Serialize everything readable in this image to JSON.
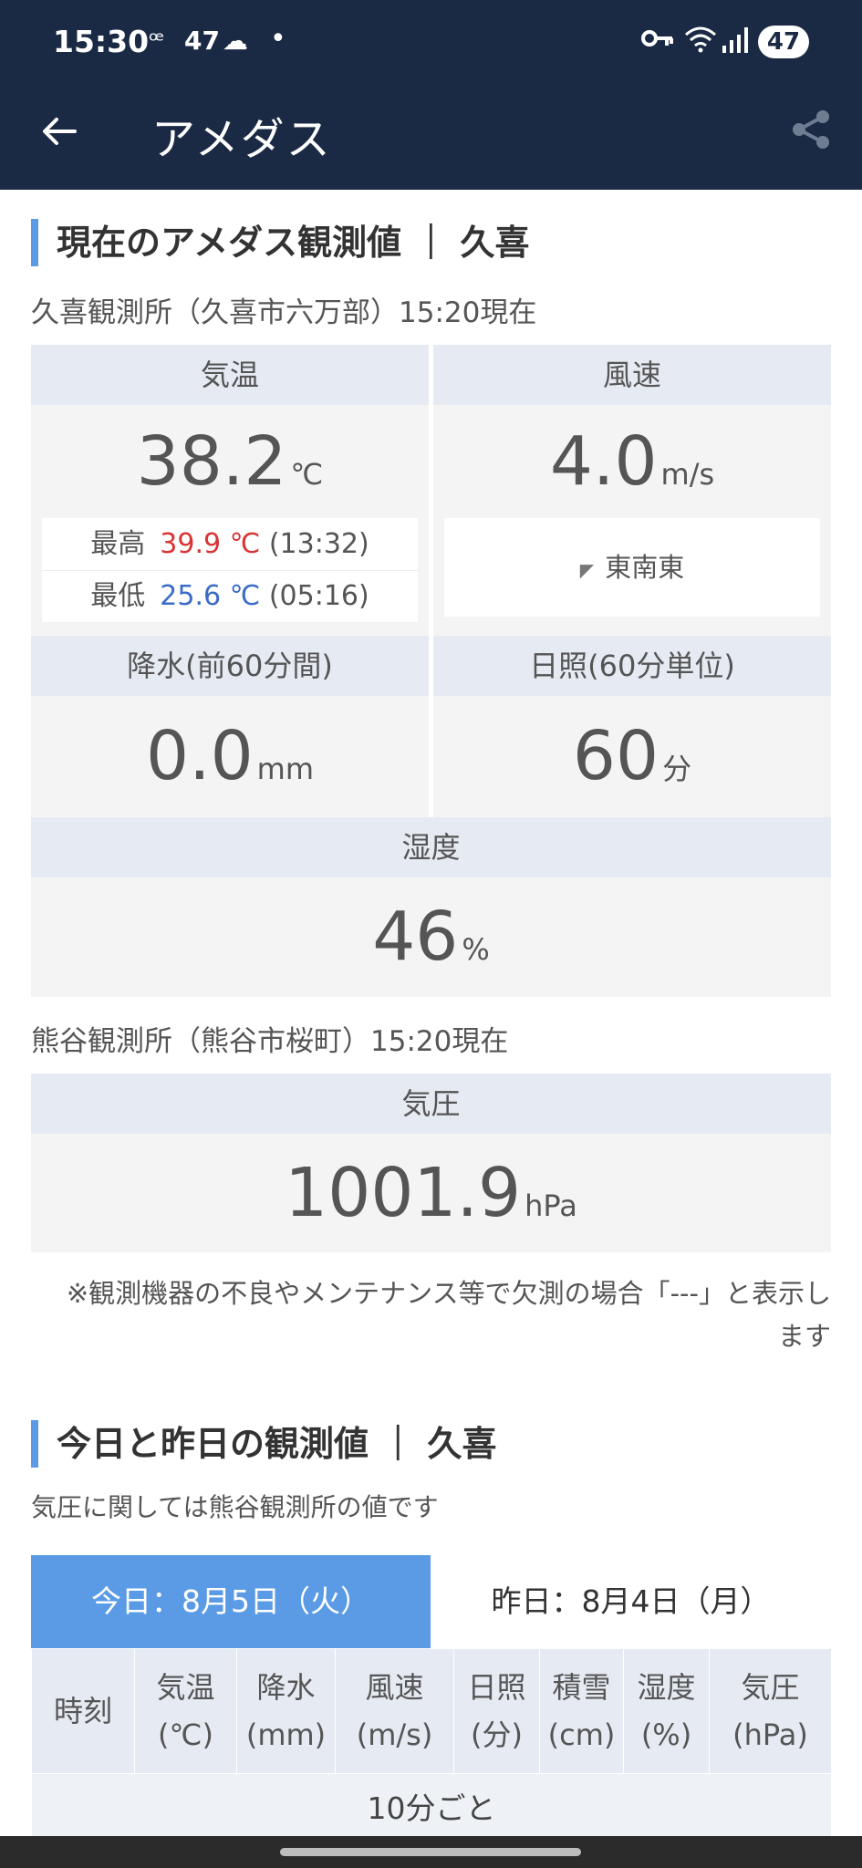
{
  "status_bar": {
    "time": "15:30",
    "temp": "47",
    "battery": "47",
    "icons": [
      "dnd-icon",
      "cloud-icon",
      "key-icon",
      "wifi-icon",
      "signal-icon",
      "battery-icon"
    ]
  },
  "app_bar": {
    "title": "アメダス",
    "icons": [
      "back-arrow-icon",
      "share-icon"
    ]
  },
  "current": {
    "section_title": "現在のアメダス観測値 ｜ 久喜",
    "station": "久喜観測所（久喜市六万部）15:20現在",
    "temperature": {
      "label": "気温",
      "value": "38.2",
      "unit": "℃",
      "max_label": "最高",
      "max_value": "39.9 ℃",
      "max_time": "(13:32)",
      "min_label": "最低",
      "min_value": "25.6 ℃",
      "min_time": "(05:16)"
    },
    "wind": {
      "label": "風速",
      "value": "4.0",
      "unit": "m/s",
      "direction": "東南東"
    },
    "precip": {
      "label": "降水(前60分間)",
      "value": "0.0",
      "unit": "mm"
    },
    "sunshine": {
      "label": "日照(60分単位)",
      "value": "60",
      "unit": "分"
    },
    "humidity": {
      "label": "湿度",
      "value": "46",
      "unit": "%"
    },
    "pressure_station": "熊谷観測所（熊谷市桜町）15:20現在",
    "pressure": {
      "label": "気圧",
      "value": "1001.9",
      "unit": "hPa"
    },
    "note": "※観測機器の不良やメンテナンス等で欠測の場合「---」と表示します"
  },
  "history": {
    "section_title": "今日と昨日の観測値 ｜ 久喜",
    "note": "気圧に関しては熊谷観測所の値です",
    "tab_today": "今日：8月5日（火）",
    "tab_yesterday": "昨日：8月4日（月）",
    "columns": [
      {
        "l1": "時刻",
        "l2": ""
      },
      {
        "l1": "気温",
        "l2": "(℃)"
      },
      {
        "l1": "降水",
        "l2": "(mm)"
      },
      {
        "l1": "風速",
        "l2": "(m/s)"
      },
      {
        "l1": "日照",
        "l2": "(分)"
      },
      {
        "l1": "積雪",
        "l2": "(cm)"
      },
      {
        "l1": "湿度",
        "l2": "(%)"
      },
      {
        "l1": "気圧",
        "l2": "(hPa)"
      }
    ],
    "interval_label": "10分ごと"
  },
  "colors": {
    "appbar": "#1b2a44",
    "accent": "#5b9be6",
    "max": "#d93434",
    "min": "#3a6bc6"
  }
}
